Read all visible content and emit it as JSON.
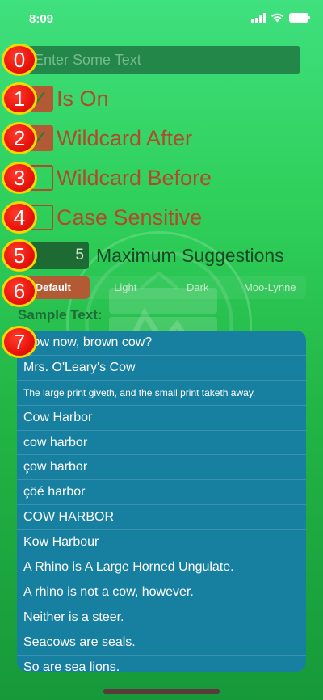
{
  "status_bar": {
    "time": "8:09"
  },
  "badges": [
    "0",
    "1",
    "2",
    "3",
    "4",
    "5",
    "6",
    "7"
  ],
  "text_field": {
    "placeholder": "Enter Some Text"
  },
  "toggles": [
    {
      "label": "Is On",
      "checked": true
    },
    {
      "label": "Wildcard After",
      "checked": true
    },
    {
      "label": "Wildcard Before",
      "checked": false
    },
    {
      "label": "Case Sensitive",
      "checked": false
    }
  ],
  "stepper": {
    "value": "5",
    "label": "Maximum Suggestions"
  },
  "segmented": {
    "options": [
      "Default",
      "Light",
      "Dark",
      "Moo-Lynne"
    ],
    "selected": "Default"
  },
  "sample_label": "Sample Text:",
  "sample_items": [
    "How now, brown cow?",
    "Mrs. O'Leary's Cow",
    "The large print giveth, and the small print taketh away.",
    "Cow Harbor",
    "cow harbor",
    "çow harbor",
    "çöé harbor",
    "COW HARBOR",
    "Kow Harbour",
    "A Rhino is A Large Horned Ungulate.",
    "A rhino is not a cow, however.",
    "Neither is a steer.",
    "Seacows are seals.",
    "So are sea lions."
  ],
  "colors": {
    "accent": "#b15a33",
    "list_background": "#1780a0",
    "badge": "#e8140c"
  }
}
